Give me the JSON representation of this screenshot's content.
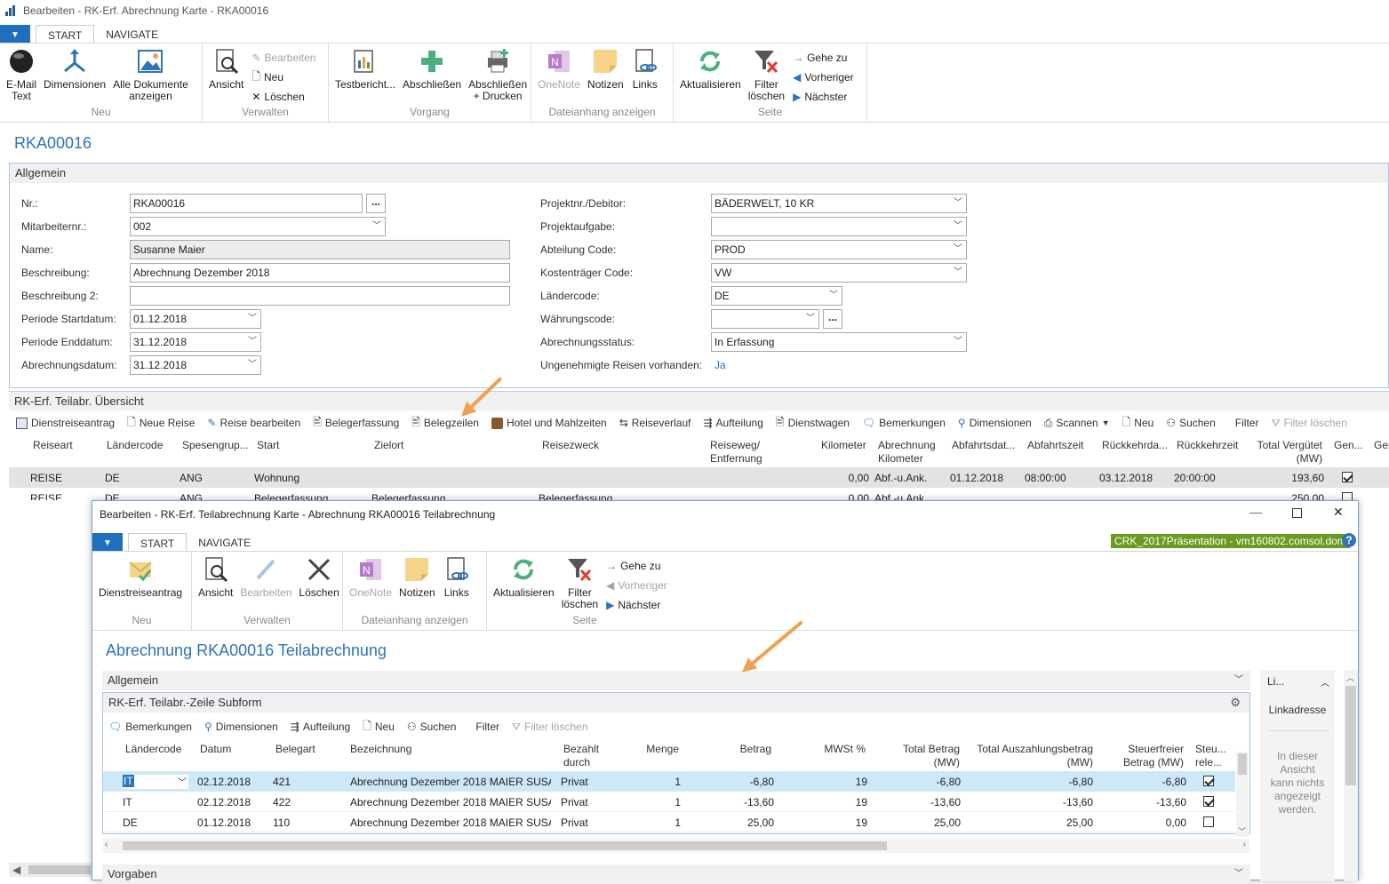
{
  "window": {
    "title": "Bearbeiten - RK-Erf. Abrechnung Karte  - RKA00016"
  },
  "tabs": [
    "START",
    "NAVIGATE"
  ],
  "ribbon": {
    "neu": {
      "label": "Neu",
      "email": "E-Mail\nText",
      "dimensionen": "Dimensionen",
      "alle": "Alle Dokumente\nanzeigen"
    },
    "verwalten": {
      "label": "Verwalten",
      "ansicht": "Ansicht",
      "bearbeiten": "Bearbeiten",
      "neu": "Neu",
      "loeschen": "Löschen"
    },
    "vorgang": {
      "label": "Vorgang",
      "testbericht": "Testbericht...",
      "abschliessen": "Abschließen",
      "abschliessen_drucken": "Abschließen\n+ Drucken"
    },
    "dateianhang": {
      "label": "Dateianhang anzeigen",
      "onenote": "OneNote",
      "notizen": "Notizen",
      "links": "Links"
    },
    "seite": {
      "label": "Seite",
      "aktualisieren": "Aktualisieren",
      "filter": "Filter\nlöschen",
      "gehe_zu": "Gehe zu",
      "vorheriger": "Vorheriger",
      "naechster": "Nächster"
    }
  },
  "page_title": "RKA00016",
  "allgemein": {
    "header": "Allgemein",
    "left": [
      {
        "label": "Nr.:",
        "value": "RKA00016"
      },
      {
        "label": "Mitarbeiternr.:",
        "value": "002"
      },
      {
        "label": "Name:",
        "value": "Susanne Maier"
      },
      {
        "label": "Beschreibung:",
        "value": "Abrechnung Dezember 2018"
      },
      {
        "label": "Beschreibung 2:",
        "value": ""
      },
      {
        "label": "Periode Startdatum:",
        "value": "01.12.2018"
      },
      {
        "label": "Periode Enddatum:",
        "value": "31.12.2018"
      },
      {
        "label": "Abrechnungsdatum:",
        "value": "31.12.2018"
      }
    ],
    "right": [
      {
        "label": "Projektnr./Debitor:",
        "value": "BÄDERWELT, 10 KR"
      },
      {
        "label": "Projektaufgabe:",
        "value": ""
      },
      {
        "label": "Abteilung Code:",
        "value": "PROD"
      },
      {
        "label": "Kostenträger Code:",
        "value": "VW"
      },
      {
        "label": "Ländercode:",
        "value": "DE"
      },
      {
        "label": "Währungscode:",
        "value": ""
      },
      {
        "label": "Abrechnungsstatus:",
        "value": "In Erfassung"
      },
      {
        "label": "Ungenehmigte Reisen vorhanden:",
        "value": "Ja"
      }
    ]
  },
  "uebersicht": {
    "header": "RK-Erf. Teilabr. Übersicht",
    "toolbar": [
      "Dienstreiseantrag",
      "Neue Reise",
      "Reise bearbeiten",
      "Belegerfassung",
      "Belegzeilen",
      "Hotel und Mahlzeiten",
      "Reiseverlauf",
      "Aufteilung",
      "Dienstwagen",
      "Bemerkungen",
      "Dimensionen",
      "Scannen",
      "Neu",
      "Suchen",
      "Filter",
      "Filter löschen"
    ],
    "columns": [
      "Reiseart",
      "Ländercode",
      "Spesengrup...",
      "Start",
      "Zielort",
      "Reisezweck",
      "Reiseweg/\nEntfernung",
      "Kilometer",
      "Abrechnung\nKilometer",
      "Abfahrtsdat...",
      "Abfahrtszeit",
      "Rückkehrda...",
      "Rückkehrzeit",
      "Total Vergütet\n(MW)",
      "Gen...",
      "Ger"
    ],
    "rows": [
      [
        "REISE",
        "DE",
        "ANG",
        "Wohnung",
        "",
        "",
        "",
        "0,00",
        "Abf.-u.Ank.",
        "01.12.2018",
        "08:00:00",
        "03.12.2018",
        "20:00:00",
        "193,60"
      ],
      [
        "REISE",
        "DE",
        "ANG",
        "Belegerfassung",
        "Belegerfassung",
        "Belegerfassung",
        "",
        "0,00",
        "Abf.-u.Ank.",
        "",
        "",
        "",
        "",
        "250,00"
      ]
    ]
  },
  "subwindow": {
    "title": "Bearbeiten - RK-Erf. Teilabrechnung Karte - Abrechnung  RKA00016  Teilabrechnung",
    "server": "CRK_2017Präsentation - vm160802.comsol.dom",
    "ribbon": {
      "neu": {
        "label": "Neu",
        "dienstreiseantrag": "Dienstreiseantrag"
      },
      "verwalten": {
        "label": "Verwalten",
        "ansicht": "Ansicht",
        "bearbeiten": "Bearbeiten",
        "loeschen": "Löschen"
      },
      "dateianhang": {
        "label": "Dateianhang anzeigen",
        "onenote": "OneNote",
        "notizen": "Notizen",
        "links": "Links"
      },
      "seite": {
        "label": "Seite",
        "aktualisieren": "Aktualisieren",
        "filter": "Filter\nlöschen",
        "gehe_zu": "Gehe zu",
        "vorheriger": "Vorheriger",
        "naechster": "Nächster"
      }
    },
    "page_title": "Abrechnung  RKA00016  Teilabrechnung",
    "allgemein": "Allgemein",
    "subform_header": "RK-Erf. Teilabr.-Zeile Subform",
    "toolbar": [
      "Bemerkungen",
      "Dimensionen",
      "Aufteilung",
      "Neu",
      "Suchen",
      "Filter",
      "Filter löschen"
    ],
    "columns": [
      "Ländercode",
      "Datum",
      "Belegart",
      "Bezeichnung",
      "Bezahlt\ndurch",
      "Menge",
      "Betrag",
      "MWSt %",
      "Total Betrag\n(MW)",
      "Total Auszahlungsbetrag\n(MW)",
      "Steuerfreier\nBetrag (MW)",
      "Steu...\nrele..."
    ],
    "rows": [
      [
        "IT",
        "02.12.2018",
        "421",
        "Abrechnung Dezember 2018 MAIER SUSA...",
        "Privat",
        "1",
        "-6,80",
        "19",
        "-6,80",
        "-6,80",
        "-6,80"
      ],
      [
        "IT",
        "02.12.2018",
        "422",
        "Abrechnung Dezember 2018 MAIER SUSA...",
        "Privat",
        "1",
        "-13,60",
        "19",
        "-13,60",
        "-13,60",
        "-13,60"
      ],
      [
        "DE",
        "01.12.2018",
        "110",
        "Abrechnung Dezember 2018 MAIER SUSA...",
        "Privat",
        "1",
        "25,00",
        "19",
        "25,00",
        "25,00",
        "0,00"
      ]
    ],
    "vorgaben": "Vorgaben",
    "side": {
      "header": "Li...",
      "linkadresse": "Linkadresse",
      "message": "In dieser\nAnsicht\nkann nichts\nangezeigt\nwerden."
    }
  },
  "colors": {
    "accent": "#2f73b8",
    "selected_row": "#cde8f7",
    "arrow": "#f0a050",
    "server_badge": "#6a9a1f"
  }
}
